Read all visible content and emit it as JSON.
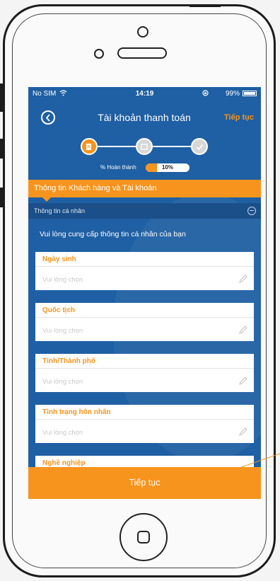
{
  "status_bar": {
    "carrier": "No SIM",
    "wifi_icon": "wifi-icon",
    "time": "14:19",
    "battery": "99%"
  },
  "nav": {
    "title": "Tài khoản thanh toán",
    "next_label": "Tiếp tục",
    "back_icon": "back-arrow-icon"
  },
  "progress": {
    "label": "% Hoàn thành",
    "value_text": "10%",
    "value": 0.1,
    "steps": [
      {
        "icon": "document-icon",
        "state": "active"
      },
      {
        "icon": "id-card-icon",
        "state": "inactive"
      },
      {
        "icon": "check-icon",
        "state": "inactive"
      }
    ]
  },
  "section": {
    "title": "Thông tin Khách hàng và Tài khoản"
  },
  "subsection": {
    "title": "Thông tin cá nhân",
    "collapse_icon": "minus-circle-icon"
  },
  "instruction": "Vui lòng cung cấp thông tin cá nhân của bạn",
  "fields": [
    {
      "label": "Ngày sinh",
      "placeholder": "Vui lòng chọn"
    },
    {
      "label": "Quốc tịch",
      "placeholder": "Vui lòng chọn"
    },
    {
      "label": "Tỉnh/Thành phố",
      "placeholder": "Vui lòng chọn"
    },
    {
      "label": "Tình trạng hôn nhân",
      "placeholder": "Vui lòng chọn"
    },
    {
      "label": "Nghề nghiệp",
      "placeholder": ""
    }
  ],
  "bottom_button": {
    "label": "Tiếp tục"
  },
  "colors": {
    "accent": "#f7941d",
    "primary": "#1f5fa3",
    "subheader": "#1a4f8a"
  }
}
